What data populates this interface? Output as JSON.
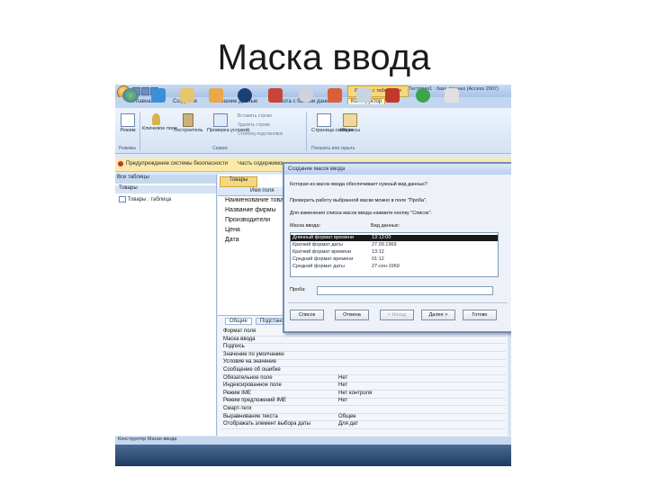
{
  "slide": {
    "title": "Маска ввода"
  },
  "window": {
    "context_tab": "Работа с таблицами",
    "title": "Тестовая1 : база данных (Access 2007)"
  },
  "ribbon": {
    "tabs": [
      "Главная",
      "Создание",
      "Внешние данные",
      "Работа с базами данных",
      "Конструктор"
    ],
    "active_tab": "Конструктор",
    "buttons": {
      "view": "Режим",
      "key_field": "Ключевое поле",
      "builder": "Построитель",
      "test_rules": "Проверка условий",
      "insert_rows": "Вставить строки",
      "delete_rows": "Удалить строки",
      "lookup_col": "Столбец подстановок",
      "property_sheet": "Страница свойств",
      "indexes": "Индексы"
    },
    "groups": {
      "views": "Режимы",
      "tools": "Сервис",
      "show_hide": "Показать или скрыть"
    }
  },
  "security_bar": {
    "text": "Предупреждение системы безопасности",
    "detail": "Часть содержимого базы данных отключена"
  },
  "nav_pane": {
    "header": "Все таблицы",
    "group": "Товары",
    "item": "Товары : таблица"
  },
  "design": {
    "doc_tab": "Товары",
    "field_header": "Имя поля",
    "fields": [
      "Наименование товара",
      "Название фирмы",
      "Производители",
      "Цена",
      "Дата"
    ]
  },
  "properties": {
    "tabs": [
      "Общие",
      "Подстановка"
    ],
    "rows": [
      {
        "name": "Формат поля",
        "value": ""
      },
      {
        "name": "Маска ввода",
        "value": ""
      },
      {
        "name": "Подпись",
        "value": ""
      },
      {
        "name": "Значение по умолчанию",
        "value": ""
      },
      {
        "name": "Условие на значение",
        "value": ""
      },
      {
        "name": "Сообщение об ошибке",
        "value": ""
      },
      {
        "name": "Обязательное поле",
        "value": "Нет"
      },
      {
        "name": "Индексированное поле",
        "value": "Нет"
      },
      {
        "name": "Режим IME",
        "value": "Нет контроля"
      },
      {
        "name": "Режим предложений IME",
        "value": "Нет"
      },
      {
        "name": "Смарт-теги",
        "value": ""
      },
      {
        "name": "Выравнивание текста",
        "value": "Общее"
      },
      {
        "name": "Отображать элемент выбора даты",
        "value": "Для дат"
      }
    ]
  },
  "status_bar": {
    "text": "Конструктор Маски ввода"
  },
  "dialog": {
    "title": "Создание масок ввода",
    "question": "Которая из масок ввода обеспечивает нужный вид данных?",
    "hint1": "Проверить работу выбранной маски можно в поле \"Проба\".",
    "hint2": "Для изменения списка масок ввода нажмите кнопку \"Список\".",
    "col_mask": "Маска ввода:",
    "col_view": "Вид данных:",
    "rows": [
      {
        "mask": "Длинный формат времени",
        "view": "13:12:00",
        "selected": true
      },
      {
        "mask": "Краткий формат даты",
        "view": "27.09.1969",
        "selected": false
      },
      {
        "mask": "Краткий формат времени",
        "view": "13:12",
        "selected": false
      },
      {
        "mask": "Средний формат времени",
        "view": "01:12",
        "selected": false
      },
      {
        "mask": "Средний формат даты",
        "view": "27-сен-1969",
        "selected": false
      }
    ],
    "trial_label": "Проба:",
    "trial_value": "",
    "buttons": {
      "list": "Список",
      "cancel": "Отмена",
      "back": "< Назад",
      "next": "Далее >",
      "finish": "Готово"
    }
  },
  "colors": {
    "ribbon_accent": "#f6d77d",
    "selection": "#1a1a1a",
    "taskbar": "#1f3a5f"
  }
}
